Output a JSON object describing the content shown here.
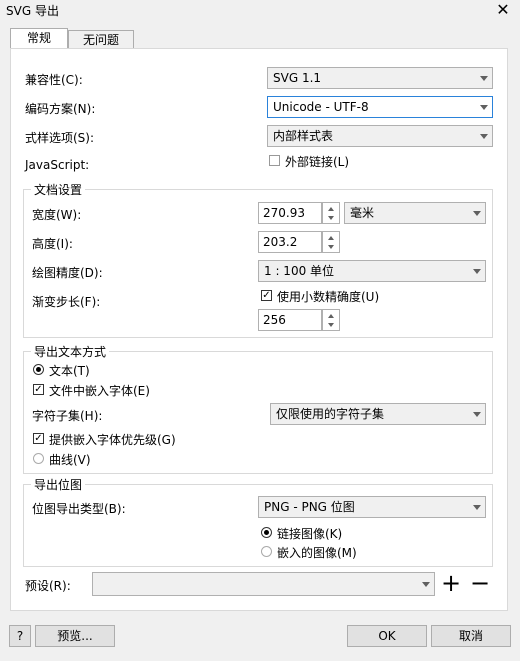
{
  "window": {
    "title": "SVG 导出",
    "close_glyph": "✕"
  },
  "tabs": [
    {
      "label": "常规",
      "active": true
    },
    {
      "label": "无问题",
      "active": false
    }
  ],
  "general": {
    "compatibility": {
      "label": "兼容性(C):",
      "value": "SVG 1.1"
    },
    "encoding": {
      "label": "编码方案(N):",
      "value": "Unicode - UTF-8"
    },
    "style_options": {
      "label": "式样选项(S):",
      "value": "内部样式表"
    },
    "javascript": {
      "label": "JavaScript:",
      "external_link_label": "外部链接(L)",
      "external_link_checked": false
    }
  },
  "document_settings": {
    "title": "文档设置",
    "width": {
      "label": "宽度(W):",
      "value": "270.93",
      "unit": "毫米"
    },
    "height": {
      "label": "高度(I):",
      "value": "203.2"
    },
    "drawing_precision": {
      "label": "绘图精度(D):",
      "value": "1 : 100 单位"
    },
    "gradient_step": {
      "label": "渐变步长(F):",
      "use_decimal_label": "使用小数精确度(U)",
      "use_decimal_checked": true,
      "value": "256"
    }
  },
  "text_export": {
    "title": "导出文本方式",
    "as_text_label": "文本(T)",
    "as_text_selected": true,
    "embed_fonts_label": "文件中嵌入字体(E)",
    "embed_fonts_checked": true,
    "subset": {
      "label": "字符子集(H):",
      "value": "仅限使用的字符子集"
    },
    "prefer_embedded_label": "提供嵌入字体优先级(G)",
    "prefer_embedded_checked": true,
    "as_curves_label": "曲线(V)",
    "as_curves_selected": false
  },
  "bitmap_export": {
    "title": "导出位图",
    "type": {
      "label": "位图导出类型(B):",
      "value": "PNG - PNG 位图"
    },
    "link_label": "链接图像(K)",
    "link_selected": true,
    "embed_label": "嵌入的图像(M)",
    "embed_selected": false
  },
  "preset": {
    "label": "预设(R):",
    "value": "",
    "add_glyph": "+",
    "remove_glyph": "−"
  },
  "footer": {
    "help": "?",
    "preview": "预览...",
    "ok": "OK",
    "cancel": "取消"
  },
  "colors": {
    "focus_border": "#2a82da",
    "panel": "#ffffff",
    "window": "#f0f0f0"
  }
}
